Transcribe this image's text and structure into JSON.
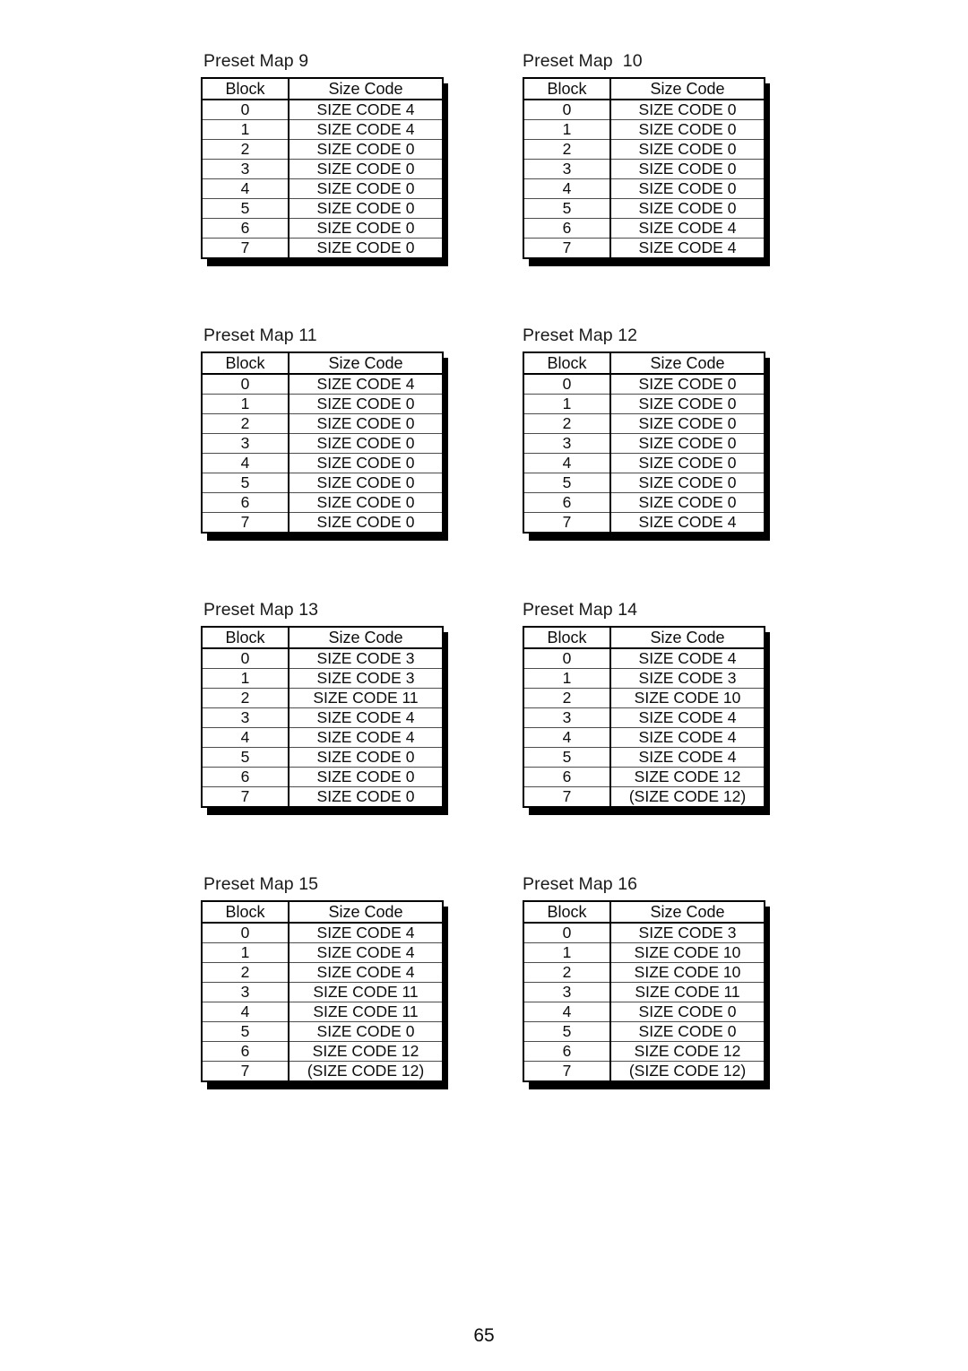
{
  "page": {
    "page_number": "65"
  },
  "table_headers": {
    "block": "Block",
    "size_code": "Size Code"
  },
  "maps": [
    {
      "title": "Preset Map 9",
      "rows": [
        {
          "block": "0",
          "size_code": "SIZE CODE 4"
        },
        {
          "block": "1",
          "size_code": "SIZE CODE 4"
        },
        {
          "block": "2",
          "size_code": "SIZE CODE 0"
        },
        {
          "block": "3",
          "size_code": "SIZE CODE 0"
        },
        {
          "block": "4",
          "size_code": "SIZE CODE 0"
        },
        {
          "block": "5",
          "size_code": "SIZE CODE 0"
        },
        {
          "block": "6",
          "size_code": "SIZE CODE 0"
        },
        {
          "block": "7",
          "size_code": "SIZE CODE 0"
        }
      ]
    },
    {
      "title": "Preset Map  10",
      "rows": [
        {
          "block": "0",
          "size_code": "SIZE CODE 0"
        },
        {
          "block": "1",
          "size_code": "SIZE CODE 0"
        },
        {
          "block": "2",
          "size_code": "SIZE CODE 0"
        },
        {
          "block": "3",
          "size_code": "SIZE CODE 0"
        },
        {
          "block": "4",
          "size_code": "SIZE CODE 0"
        },
        {
          "block": "5",
          "size_code": "SIZE CODE 0"
        },
        {
          "block": "6",
          "size_code": "SIZE CODE 4"
        },
        {
          "block": "7",
          "size_code": "SIZE CODE 4"
        }
      ]
    },
    {
      "title": "Preset Map 11",
      "rows": [
        {
          "block": "0",
          "size_code": "SIZE CODE 4"
        },
        {
          "block": "1",
          "size_code": "SIZE CODE 0"
        },
        {
          "block": "2",
          "size_code": "SIZE CODE 0"
        },
        {
          "block": "3",
          "size_code": "SIZE CODE 0"
        },
        {
          "block": "4",
          "size_code": "SIZE CODE 0"
        },
        {
          "block": "5",
          "size_code": "SIZE CODE 0"
        },
        {
          "block": "6",
          "size_code": "SIZE CODE 0"
        },
        {
          "block": "7",
          "size_code": "SIZE CODE 0"
        }
      ]
    },
    {
      "title": "Preset Map 12",
      "rows": [
        {
          "block": "0",
          "size_code": "SIZE CODE 0"
        },
        {
          "block": "1",
          "size_code": "SIZE CODE 0"
        },
        {
          "block": "2",
          "size_code": "SIZE CODE 0"
        },
        {
          "block": "3",
          "size_code": "SIZE CODE 0"
        },
        {
          "block": "4",
          "size_code": "SIZE CODE 0"
        },
        {
          "block": "5",
          "size_code": "SIZE CODE 0"
        },
        {
          "block": "6",
          "size_code": "SIZE CODE 0"
        },
        {
          "block": "7",
          "size_code": "SIZE CODE 4"
        }
      ]
    },
    {
      "title": "Preset Map 13",
      "rows": [
        {
          "block": "0",
          "size_code": "SIZE CODE 3"
        },
        {
          "block": "1",
          "size_code": "SIZE CODE 3"
        },
        {
          "block": "2",
          "size_code": "SIZE CODE 11"
        },
        {
          "block": "3",
          "size_code": "SIZE CODE 4"
        },
        {
          "block": "4",
          "size_code": "SIZE CODE 4"
        },
        {
          "block": "5",
          "size_code": "SIZE CODE 0"
        },
        {
          "block": "6",
          "size_code": "SIZE CODE 0"
        },
        {
          "block": "7",
          "size_code": "SIZE CODE 0"
        }
      ]
    },
    {
      "title": "Preset Map 14",
      "rows": [
        {
          "block": "0",
          "size_code": "SIZE CODE 4"
        },
        {
          "block": "1",
          "size_code": "SIZE CODE 3"
        },
        {
          "block": "2",
          "size_code": "SIZE CODE 10"
        },
        {
          "block": "3",
          "size_code": "SIZE CODE 4"
        },
        {
          "block": "4",
          "size_code": "SIZE CODE 4"
        },
        {
          "block": "5",
          "size_code": "SIZE CODE 4"
        },
        {
          "block": "6",
          "size_code": "SIZE CODE 12"
        },
        {
          "block": "7",
          "size_code": "(SIZE CODE 12)"
        }
      ]
    },
    {
      "title": "Preset Map 15",
      "rows": [
        {
          "block": "0",
          "size_code": "SIZE CODE 4"
        },
        {
          "block": "1",
          "size_code": "SIZE CODE 4"
        },
        {
          "block": "2",
          "size_code": "SIZE CODE 4"
        },
        {
          "block": "3",
          "size_code": "SIZE CODE 11"
        },
        {
          "block": "4",
          "size_code": "SIZE CODE 11"
        },
        {
          "block": "5",
          "size_code": "SIZE CODE 0"
        },
        {
          "block": "6",
          "size_code": "SIZE CODE 12"
        },
        {
          "block": "7",
          "size_code": "(SIZE CODE 12)"
        }
      ]
    },
    {
      "title": "Preset Map 16",
      "rows": [
        {
          "block": "0",
          "size_code": "SIZE CODE 3"
        },
        {
          "block": "1",
          "size_code": "SIZE CODE 10"
        },
        {
          "block": "2",
          "size_code": "SIZE CODE 10"
        },
        {
          "block": "3",
          "size_code": "SIZE CODE 11"
        },
        {
          "block": "4",
          "size_code": "SIZE CODE 0"
        },
        {
          "block": "5",
          "size_code": "SIZE CODE 0"
        },
        {
          "block": "6",
          "size_code": "SIZE CODE 12"
        },
        {
          "block": "7",
          "size_code": "(SIZE CODE 12)"
        }
      ]
    }
  ]
}
